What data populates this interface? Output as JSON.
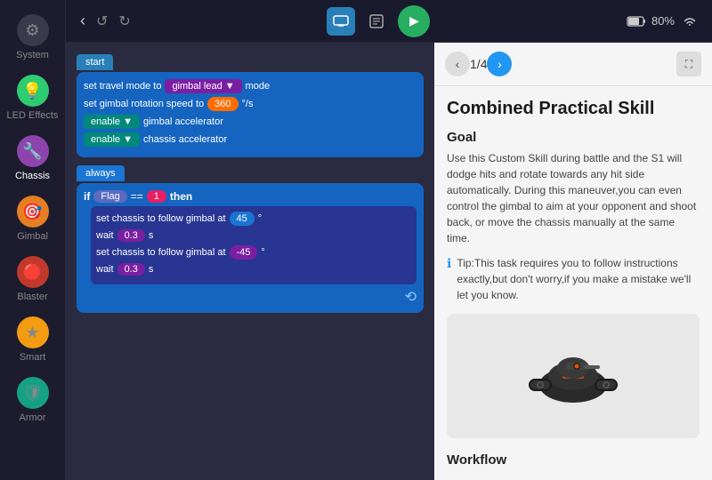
{
  "sidebar": {
    "items": [
      {
        "label": "System",
        "icon": "⚙",
        "colorClass": "gray",
        "active": false
      },
      {
        "label": "LED Effects",
        "icon": "💡",
        "colorClass": "green",
        "active": false
      },
      {
        "label": "Chassis",
        "icon": "🔧",
        "colorClass": "purple",
        "active": true
      },
      {
        "label": "Gimbal",
        "icon": "🎯",
        "colorClass": "orange",
        "active": false
      },
      {
        "label": "Blaster",
        "icon": "🔴",
        "colorClass": "red",
        "active": false
      },
      {
        "label": "Smart",
        "icon": "★",
        "colorClass": "yellow",
        "active": false
      },
      {
        "label": "Armor",
        "icon": "🛡",
        "colorClass": "teal",
        "active": false
      }
    ]
  },
  "topbar": {
    "back_label": "‹",
    "undo_label": "↺",
    "redo_label": "↻",
    "monitor_label": "⬛",
    "checklist_label": "☑",
    "play_label": "▶",
    "battery": "80%",
    "wifi": "WiFi"
  },
  "blocks": {
    "start_label": "start",
    "always_label": "always",
    "rows": [
      {
        "text": "set travel mode to",
        "btn": "gimbal lead ▼",
        "suffix": "mode"
      },
      {
        "text": "set gimbal rotation speed to",
        "value": "360",
        "suffix": "°/s"
      },
      {
        "text": "enable ▼",
        "btn2": "gimbal accelerator"
      },
      {
        "text": "enable ▼",
        "btn2": "chassis accelerator"
      }
    ],
    "if_row": {
      "keyword_if": "if",
      "flag": "Flag",
      "eq": "==",
      "val": "1",
      "keyword_then": "then"
    },
    "then_rows": [
      {
        "text": "set chassis to follow gimbal at",
        "value": "45",
        "suffix": "°"
      },
      {
        "wait_label": "wait",
        "wait_val": "0.3",
        "s": "s"
      },
      {
        "text": "set chassis to follow gimbal at",
        "value": "-45",
        "suffix": "°"
      },
      {
        "wait_label": "wait",
        "wait_val": "0.3",
        "s": "s"
      }
    ],
    "repeat_icon": "⟲"
  },
  "panel": {
    "page_current": "1",
    "page_total": "4",
    "title": "Combined Practical Skill",
    "goal_label": "Goal",
    "goal_text": "Use this Custom Skill during battle and the S1 will dodge hits and rotate towards any hit side automatically. During this maneuver,you can even control the gimbal to aim at your opponent and shoot back, or move the chassis manually at the same time.",
    "tip_icon": "ℹ",
    "tip_text": "Tip:This task requires you to follow instructions exactly,but don't worry,if you make a mistake we'll let you know.",
    "workflow_label": "Workflow"
  }
}
